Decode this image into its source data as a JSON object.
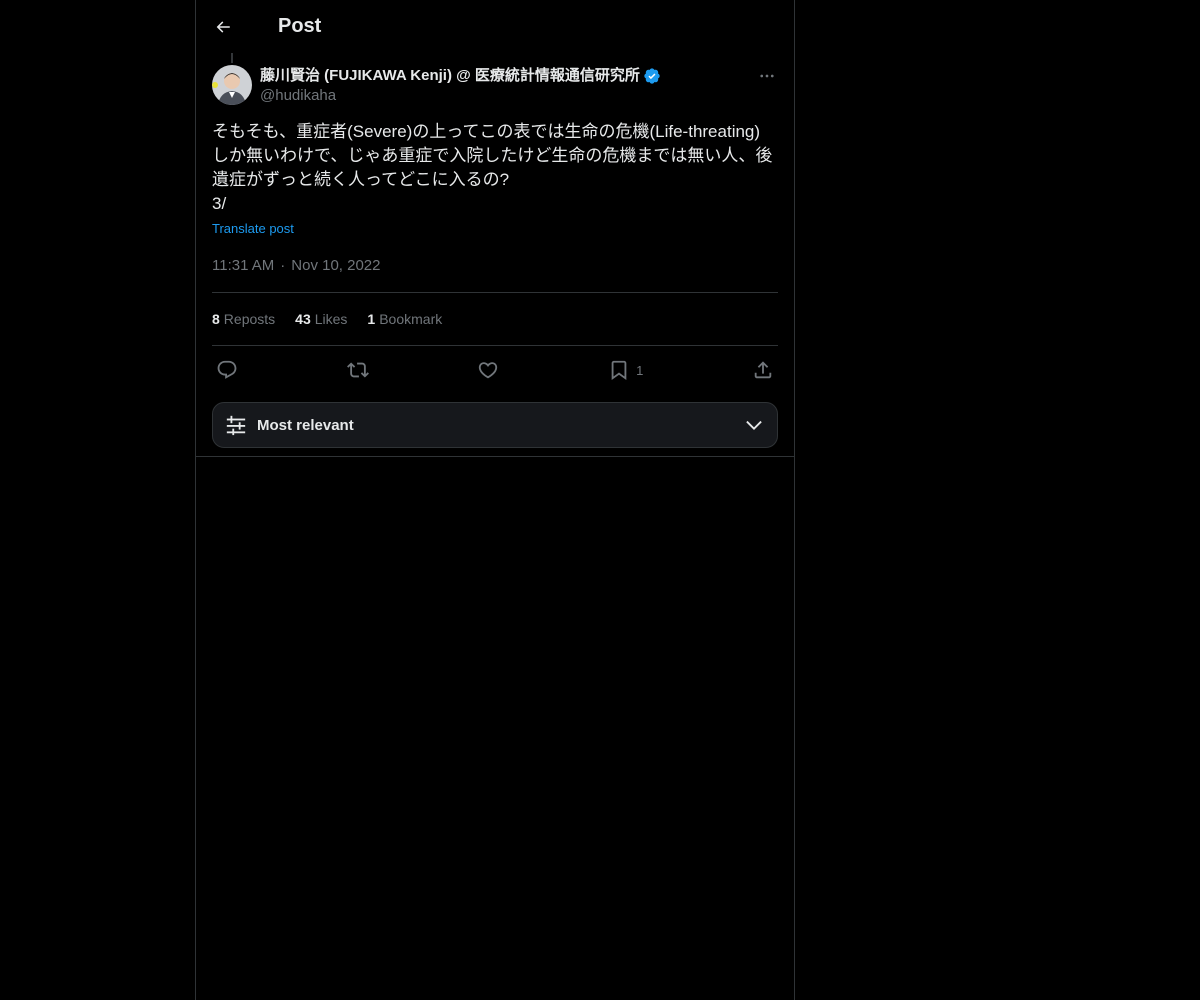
{
  "header": {
    "back_icon": "arrow-left-icon",
    "title": "Post"
  },
  "post": {
    "author": {
      "name": "藤川賢治 (FUJIKAWA Kenji) @ 医療統計情報通信研究所",
      "handle": "@hudikaha",
      "verified_icon": "verified-badge-icon",
      "verified_color": "#1d9bf0"
    },
    "text": "そもそも、重症者(Severe)の上ってこの表では生命の危機(Life-threating)\nしか無いわけで、じゃあ重症で入院したけど生命の危機までは無い人、後\n遺症がずっと続く人ってどこに入るの?\n3/",
    "translate_label": "Translate post",
    "time": "11:31 AM",
    "separator": "·",
    "date": "Nov 10, 2022",
    "stats": {
      "reposts_count": "8",
      "reposts_label": "Reposts",
      "likes_count": "43",
      "likes_label": "Likes",
      "bookmarks_count": "1",
      "bookmarks_label": "Bookmark"
    },
    "actions": {
      "reply_icon": "reply-icon",
      "repost_icon": "repost-icon",
      "like_icon": "heart-icon",
      "bookmark_icon": "bookmark-icon",
      "bookmark_count": "1",
      "share_icon": "share-icon"
    }
  },
  "sort": {
    "icon": "sliders-icon",
    "label": "Most relevant",
    "chevron_icon": "chevron-down-icon"
  },
  "colors": {
    "background": "#000000",
    "text": "#e7e9ea",
    "muted": "#71767b",
    "accent": "#1d9bf0",
    "border": "#2f3336"
  }
}
